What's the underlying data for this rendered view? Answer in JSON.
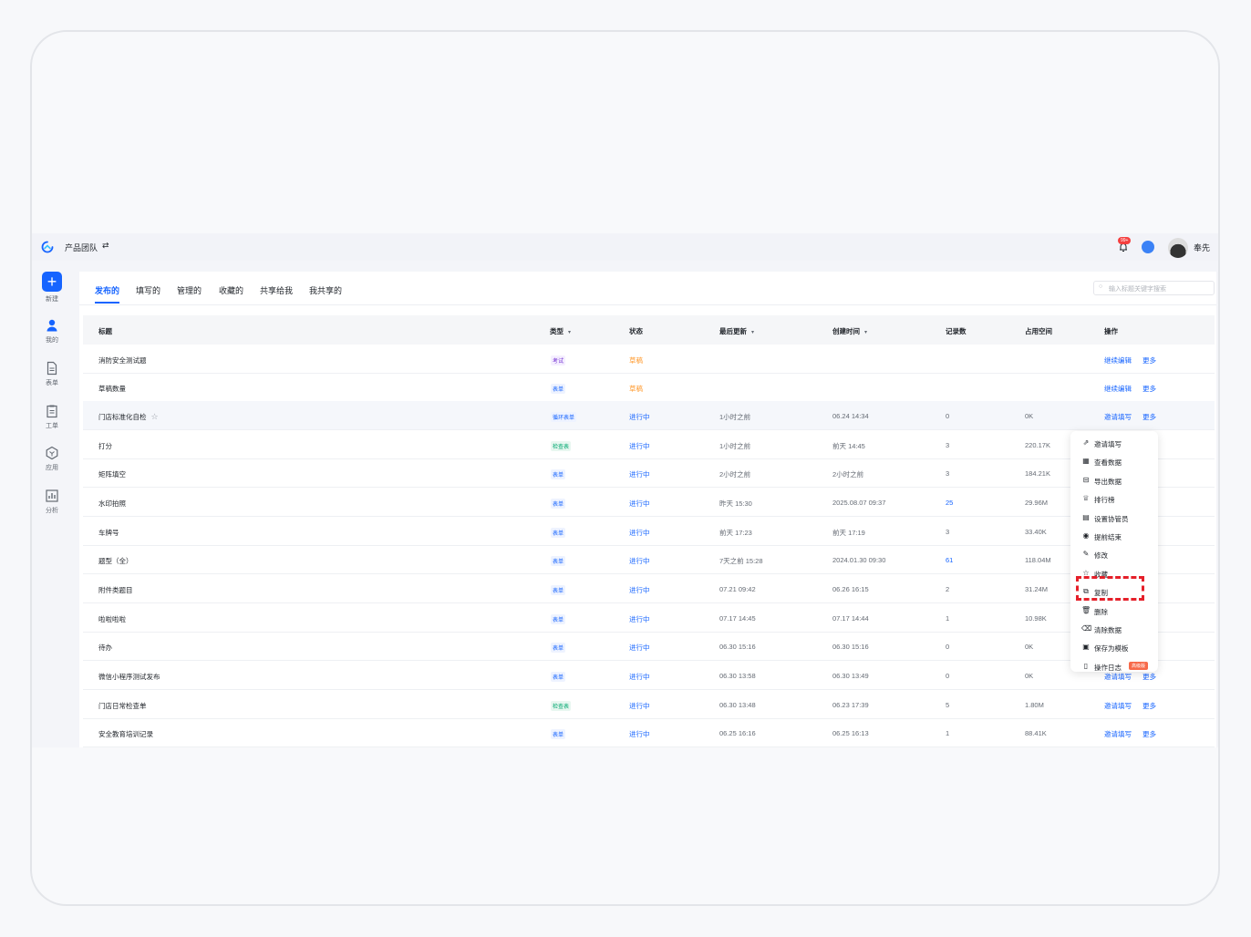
{
  "header": {
    "team_name": "产品团队",
    "switch_icon": "⇄",
    "notification_badge": "99+",
    "username": "奉先"
  },
  "sidebar": {
    "items": [
      {
        "label": "新建",
        "icon": "plus-icon"
      },
      {
        "label": "我的",
        "icon": "user-icon"
      },
      {
        "label": "表单",
        "icon": "document-icon"
      },
      {
        "label": "工单",
        "icon": "clipboard-icon"
      },
      {
        "label": "应用",
        "icon": "app-icon"
      },
      {
        "label": "分析",
        "icon": "chart-icon"
      }
    ]
  },
  "tabs": [
    {
      "label": "发布的",
      "active": true
    },
    {
      "label": "填写的"
    },
    {
      "label": "管理的"
    },
    {
      "label": "收藏的"
    },
    {
      "label": "共享给我"
    },
    {
      "label": "我共享的"
    }
  ],
  "search": {
    "placeholder": "输入标题关键字搜索"
  },
  "table": {
    "headers": [
      "标题",
      "类型",
      "状态",
      "最后更新",
      "创建时间",
      "记录数",
      "占用空间",
      "操作"
    ],
    "rows": [
      {
        "title": "消防安全测试题",
        "type": "考试",
        "type_color": "purple",
        "status": "草稿",
        "status_kind": "draft",
        "updated": "",
        "created": "",
        "records": "",
        "size": "",
        "actions": [
          "继续编辑",
          "更多"
        ]
      },
      {
        "title": "草稿数量",
        "type": "表单",
        "type_color": "blue",
        "status": "草稿",
        "status_kind": "draft",
        "updated": "",
        "created": "",
        "records": "",
        "size": "",
        "actions": [
          "继续编辑",
          "更多"
        ]
      },
      {
        "title": "门店标准化自检",
        "star": "☆",
        "type": "循环表单",
        "type_color": "blue",
        "status": "进行中",
        "status_kind": "run",
        "updated": "1小时之前",
        "created": "06.24 14:34",
        "records": "0",
        "size": "0K",
        "actions": [
          "邀请填写",
          "更多"
        ]
      },
      {
        "title": "打分",
        "type": "检查表",
        "type_color": "green",
        "status": "进行中",
        "status_kind": "run",
        "updated": "1小时之前",
        "created": "前天 14:45",
        "records": "3",
        "size": "220.17K",
        "actions": []
      },
      {
        "title": "矩阵填空",
        "type": "表单",
        "type_color": "blue",
        "status": "进行中",
        "status_kind": "run",
        "updated": "2小时之前",
        "created": "2小时之前",
        "records": "3",
        "size": "184.21K",
        "actions": []
      },
      {
        "title": "水印拍照",
        "type": "表单",
        "type_color": "blue",
        "status": "进行中",
        "status_kind": "run",
        "updated": "昨天 15:30",
        "created": "2025.08.07 09:37",
        "records": "25",
        "records_blue": true,
        "size": "29.96M",
        "actions": []
      },
      {
        "title": "车牌号",
        "type": "表单",
        "type_color": "blue",
        "status": "进行中",
        "status_kind": "run",
        "updated": "前天 17:23",
        "created": "前天 17:19",
        "records": "3",
        "size": "33.40K",
        "actions": []
      },
      {
        "title": "题型（全）",
        "type": "表单",
        "type_color": "blue",
        "status": "进行中",
        "status_kind": "run",
        "updated": "7天之前 15:28",
        "created": "2024.01.30 09:30",
        "records": "61",
        "records_blue": true,
        "size": "118.04M",
        "actions": []
      },
      {
        "title": "附件类题目",
        "type": "表单",
        "type_color": "blue",
        "status": "进行中",
        "status_kind": "run",
        "updated": "07.21 09:42",
        "created": "06.26 16:15",
        "records": "2",
        "size": "31.24M",
        "actions": []
      },
      {
        "title": "啦啦啦啦",
        "type": "表单",
        "type_color": "blue",
        "status": "进行中",
        "status_kind": "run",
        "updated": "07.17 14:45",
        "created": "07.17 14:44",
        "records": "1",
        "size": "10.98K",
        "actions": []
      },
      {
        "title": "待办",
        "type": "表单",
        "type_color": "blue",
        "status": "进行中",
        "status_kind": "run",
        "updated": "06.30 15:16",
        "created": "06.30 15:16",
        "records": "0",
        "size": "0K",
        "actions": []
      },
      {
        "title": "微信小程序测试发布",
        "type": "表单",
        "type_color": "blue",
        "status": "进行中",
        "status_kind": "run",
        "updated": "06.30 13:58",
        "created": "06.30 13:49",
        "records": "0",
        "size": "0K",
        "actions": [
          "邀请填写",
          "更多"
        ]
      },
      {
        "title": "门店日常检查单",
        "type": "检查表",
        "type_color": "green",
        "status": "进行中",
        "status_kind": "run",
        "updated": "06.30 13:48",
        "created": "06.23 17:39",
        "records": "5",
        "size": "1.80M",
        "actions": [
          "邀请填写",
          "更多"
        ]
      },
      {
        "title": "安全教育培训记录",
        "type": "表单",
        "type_color": "blue",
        "status": "进行中",
        "status_kind": "run",
        "updated": "06.25 16:16",
        "created": "06.25 16:13",
        "records": "1",
        "size": "88.41K",
        "actions": [
          "邀请填写",
          "更多"
        ]
      }
    ]
  },
  "more_menu": {
    "items": [
      {
        "label": "邀请填写",
        "icon": "share-icon",
        "glyph": "⇗"
      },
      {
        "label": "查看数据",
        "icon": "data-icon",
        "glyph": "▦"
      },
      {
        "label": "导出数据",
        "icon": "export-icon",
        "glyph": "⊟"
      },
      {
        "label": "排行榜",
        "icon": "trophy-icon",
        "glyph": "♕"
      },
      {
        "label": "设置协管员",
        "icon": "admin-icon",
        "glyph": "▤"
      },
      {
        "label": "提前结束",
        "icon": "stop-icon",
        "glyph": "◉"
      },
      {
        "label": "修改",
        "icon": "edit-icon",
        "glyph": "✎"
      },
      {
        "label": "收藏",
        "icon": "star-icon",
        "glyph": "☆"
      },
      {
        "label": "复制",
        "icon": "copy-icon",
        "glyph": "⧉"
      },
      {
        "label": "删除",
        "icon": "trash-icon",
        "glyph": "🗑"
      },
      {
        "label": "清除数据",
        "icon": "clear-icon",
        "glyph": "⌫"
      },
      {
        "label": "保存为模板",
        "icon": "template-icon",
        "glyph": "▣"
      },
      {
        "label": "操作日志",
        "icon": "log-icon",
        "glyph": "▯",
        "badge": "高级版"
      }
    ]
  }
}
